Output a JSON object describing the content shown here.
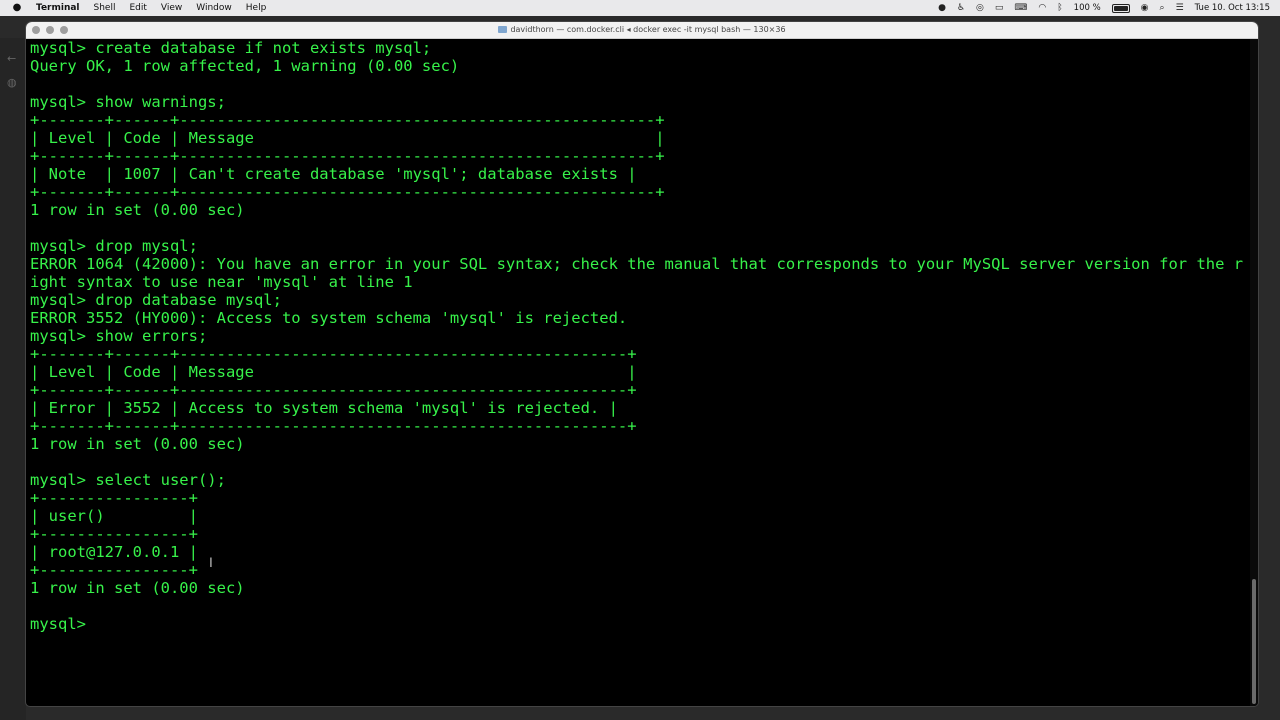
{
  "menubar": {
    "apple_icon": "apple-icon",
    "items": [
      "Terminal",
      "Shell",
      "Edit",
      "View",
      "Window",
      "Help"
    ],
    "battery_percent": "100 %",
    "clock": "Tue 10. Oct  13:15"
  },
  "terminal": {
    "title": "davidthorn — com.docker.cli ◂ docker exec -it mysql bash — 130×36",
    "lines": [
      "mysql> create database if not exists mysql;",
      "Query OK, 1 row affected, 1 warning (0.00 sec)",
      "",
      "mysql> show warnings;",
      "+-------+------+---------------------------------------------------+",
      "| Level | Code | Message                                           |",
      "+-------+------+---------------------------------------------------+",
      "| Note  | 1007 | Can't create database 'mysql'; database exists |",
      "+-------+------+---------------------------------------------------+",
      "1 row in set (0.00 sec)",
      "",
      "mysql> drop mysql;",
      "ERROR 1064 (42000): You have an error in your SQL syntax; check the manual that corresponds to your MySQL server version for the r",
      "ight syntax to use near 'mysql' at line 1",
      "mysql> drop database mysql;",
      "ERROR 3552 (HY000): Access to system schema 'mysql' is rejected.",
      "mysql> show errors;",
      "+-------+------+------------------------------------------------+",
      "| Level | Code | Message                                        |",
      "+-------+------+------------------------------------------------+",
      "| Error | 3552 | Access to system schema 'mysql' is rejected. |",
      "+-------+------+------------------------------------------------+",
      "1 row in set (0.00 sec)",
      "",
      "mysql> select user();",
      "+----------------+",
      "| user()         |",
      "+----------------+",
      "| root@127.0.0.1 |",
      "+----------------+",
      "1 row in set (0.00 sec)",
      "",
      "mysql> "
    ]
  },
  "colors": {
    "terminal_text": "#37f24a",
    "terminal_bg": "#000000"
  }
}
